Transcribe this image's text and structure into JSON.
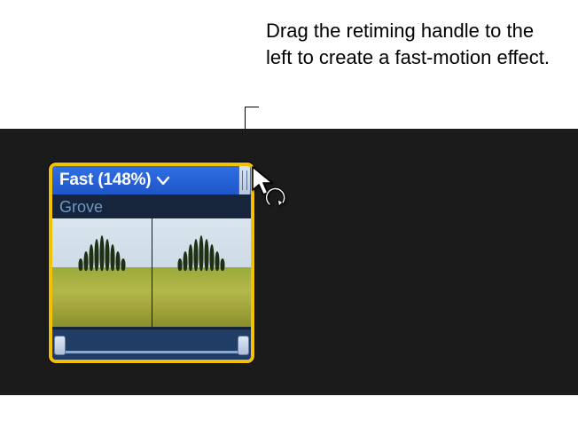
{
  "callout": {
    "text": "Drag the retiming handle to the left to create a fast-motion effect."
  },
  "clip": {
    "retime_label": "Fast (148%)",
    "name": "Grove"
  }
}
